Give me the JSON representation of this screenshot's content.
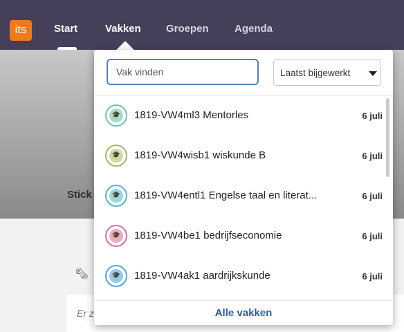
{
  "app": {
    "logo_text": "its"
  },
  "nav": {
    "items": [
      {
        "label": "Start"
      },
      {
        "label": "Vakken"
      },
      {
        "label": "Groepen"
      },
      {
        "label": "Agenda"
      }
    ]
  },
  "background": {
    "banner_text": "Stick",
    "card_text": "Er z"
  },
  "dropdown": {
    "search": {
      "placeholder": "Vak vinden",
      "value": ""
    },
    "sort": {
      "selected": "Laatst bijgewerkt"
    },
    "courses": [
      {
        "name": "1819-VW4ml3 Mentorles",
        "date": "6 juli",
        "color": "#6fc6a8",
        "fill": "#a6dcc8"
      },
      {
        "name": "1819-VW4wisb1 wiskunde B",
        "date": "6 juli",
        "color": "#a4b865",
        "fill": "#cfdba5"
      },
      {
        "name": "1819-VW4entl1 Engelse taal en literat...",
        "date": "6 juli",
        "color": "#52b8cf",
        "fill": "#9ad8e6"
      },
      {
        "name": "1819-VW4be1 bedrijfseconomie",
        "date": "6 juli",
        "color": "#d9719d",
        "fill": "#eeaac6"
      },
      {
        "name": "1819-VW4ak1 aardrijkskunde",
        "date": "6 juli",
        "color": "#4fa6de",
        "fill": "#93cbef"
      }
    ],
    "footer_link": "Alle vakken"
  }
}
